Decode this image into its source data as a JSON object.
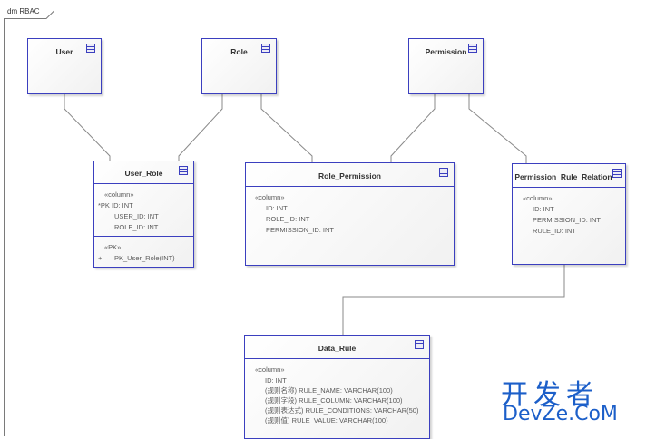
{
  "frame": {
    "label": "dm RBAC"
  },
  "boxes": {
    "user": {
      "title": "User",
      "icon": "class-icon"
    },
    "role": {
      "title": "Role",
      "icon": "class-icon"
    },
    "permission": {
      "title": "Permission",
      "icon": "class-icon"
    },
    "user_role": {
      "title": "User_Role",
      "stereotype": "«column»",
      "columns": [
        "*PK  ID: INT",
        "USER_ID: INT",
        "ROLE_ID: INT"
      ],
      "pk_stereotype": "«PK»",
      "pk_marker": "+",
      "pk_op": "PK_User_Role(INT)"
    },
    "role_permission": {
      "title": "Role_Permission",
      "stereotype": "«column»",
      "columns": [
        "ID: INT",
        "ROLE_ID: INT",
        "PERMISSION_ID: INT"
      ]
    },
    "permission_rule_relation": {
      "title": "Permission_Rule_Relation",
      "stereotype": "«column»",
      "columns": [
        "ID: INT",
        "PERMISSION_ID: INT",
        "RULE_ID: INT"
      ]
    },
    "data_rule": {
      "title": "Data_Rule",
      "stereotype": "«column»",
      "columns": [
        "ID: INT",
        "(规则名称) RULE_NAME: VARCHAR(100)",
        "(规则字段) RULE_COLUMN: VARCHAR(100)",
        "(规则表达式) RULE_CONDITIONS: VARCHAR(50)",
        "(规则值) RULE_VALUE: VARCHAR(100)"
      ]
    }
  },
  "watermark": {
    "top": "开发者",
    "bottom": "DevZe.CoM"
  },
  "colors": {
    "border": "#3b3fbf",
    "connector": "#8a8a8a",
    "watermark": "#1c5fc9"
  }
}
